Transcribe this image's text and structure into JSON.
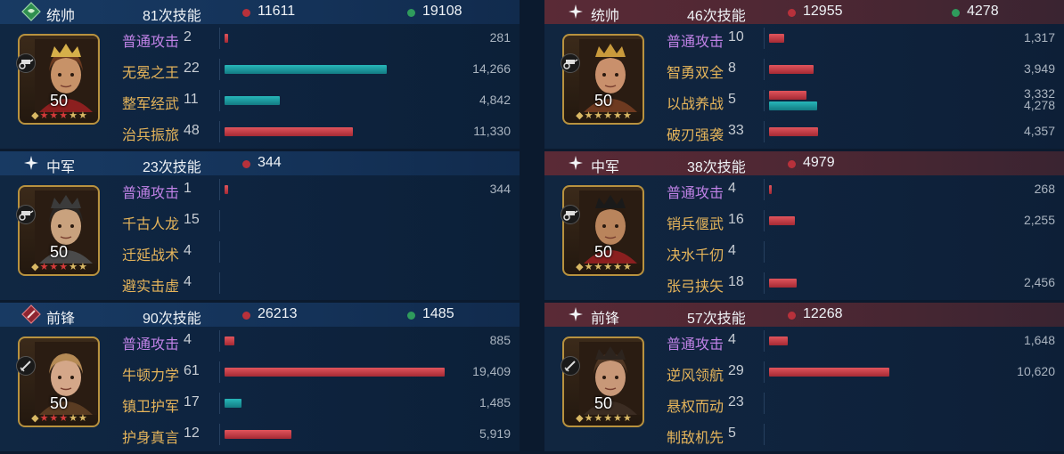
{
  "colors": {
    "damage_red": "#c23a44",
    "heal_teal": "#1b9ea3",
    "basic_attack_purple": "#c082e6",
    "skill_gold": "#e5b45a",
    "left_header": "#163660",
    "right_header": "#4f2733",
    "frame_gold": "#b8923f"
  },
  "left": {
    "sections": [
      {
        "role": "统帅",
        "role_icon": "green-diamond-badge-icon",
        "skill_count": "81次技能",
        "damage_total": "11611",
        "heal_total": "19108",
        "troop_icon": "chariot-icon",
        "level": "50",
        "stars": "red-3-gold-2",
        "skills": [
          {
            "name": "普通攻击",
            "count": "2",
            "bars": [
              {
                "color": "red",
                "value": 281,
                "label": "281"
              }
            ]
          },
          {
            "name": "无冕之王",
            "count": "22",
            "bars": [
              {
                "color": "teal",
                "value": 14266,
                "label": "14,266"
              }
            ]
          },
          {
            "name": "整军经武",
            "count": "11",
            "bars": [
              {
                "color": "teal",
                "value": 4842,
                "label": "4,842"
              }
            ]
          },
          {
            "name": "治兵振旅",
            "count": "48",
            "bars": [
              {
                "color": "red",
                "value": 11330,
                "label": "11,330"
              }
            ]
          }
        ]
      },
      {
        "role": "中军",
        "role_icon": "white-star-icon",
        "skill_count": "23次技能",
        "damage_total": "344",
        "heal_total": "",
        "troop_icon": "chariot-icon",
        "level": "50",
        "stars": "red-3-gold-2",
        "skills": [
          {
            "name": "普通攻击",
            "count": "1",
            "bars": [
              {
                "color": "red",
                "value": 344,
                "label": "344"
              }
            ]
          },
          {
            "name": "千古人龙",
            "count": "15",
            "bars": []
          },
          {
            "name": "迁延战术",
            "count": "4",
            "bars": []
          },
          {
            "name": "避实击虚",
            "count": "4",
            "bars": []
          }
        ]
      },
      {
        "role": "前锋",
        "role_icon": "red-sword-diamond-icon",
        "skill_count": "90次技能",
        "damage_total": "26213",
        "heal_total": "1485",
        "troop_icon": "sword-icon",
        "level": "50",
        "stars": "red-3-gold-2",
        "skills": [
          {
            "name": "普通攻击",
            "count": "4",
            "bars": [
              {
                "color": "red",
                "value": 885,
                "label": "885"
              }
            ]
          },
          {
            "name": "牛顿力学",
            "count": "61",
            "bars": [
              {
                "color": "red",
                "value": 19409,
                "label": "19,409"
              }
            ]
          },
          {
            "name": "镇卫护军",
            "count": "17",
            "bars": [
              {
                "color": "teal",
                "value": 1485,
                "label": "1,485"
              }
            ]
          },
          {
            "name": "护身真言",
            "count": "12",
            "bars": [
              {
                "color": "red",
                "value": 5919,
                "label": "5,919"
              }
            ]
          }
        ]
      }
    ]
  },
  "right": {
    "sections": [
      {
        "role": "统帅",
        "role_icon": "white-star-icon",
        "skill_count": "46次技能",
        "damage_total": "12955",
        "heal_total": "4278",
        "troop_icon": "chariot-icon",
        "level": "50",
        "stars": "gold-5",
        "skills": [
          {
            "name": "普通攻击",
            "count": "10",
            "bars": [
              {
                "color": "red",
                "value": 1317,
                "label": "1,317"
              }
            ]
          },
          {
            "name": "智勇双全",
            "count": "8",
            "bars": [
              {
                "color": "red",
                "value": 3949,
                "label": "3,949"
              }
            ]
          },
          {
            "name": "以战养战",
            "count": "5",
            "bars": [
              {
                "color": "red",
                "value": 3332,
                "label": "3,332"
              },
              {
                "color": "teal",
                "value": 4278,
                "label": "4,278"
              }
            ]
          },
          {
            "name": "破刃强袭",
            "count": "33",
            "bars": [
              {
                "color": "red",
                "value": 4357,
                "label": "4,357"
              }
            ]
          }
        ]
      },
      {
        "role": "中军",
        "role_icon": "white-star-icon",
        "skill_count": "38次技能",
        "damage_total": "4979",
        "heal_total": "",
        "troop_icon": "chariot-icon",
        "level": "50",
        "stars": "gold-5",
        "skills": [
          {
            "name": "普通攻击",
            "count": "4",
            "bars": [
              {
                "color": "red",
                "value": 268,
                "label": "268"
              }
            ]
          },
          {
            "name": "销兵偃武",
            "count": "16",
            "bars": [
              {
                "color": "red",
                "value": 2255,
                "label": "2,255"
              }
            ]
          },
          {
            "name": "决水千仞",
            "count": "4",
            "bars": []
          },
          {
            "name": "张弓挟矢",
            "count": "18",
            "bars": [
              {
                "color": "red",
                "value": 2456,
                "label": "2,456"
              }
            ]
          }
        ]
      },
      {
        "role": "前锋",
        "role_icon": "white-star-icon",
        "skill_count": "57次技能",
        "damage_total": "12268",
        "heal_total": "",
        "troop_icon": "sword-icon",
        "level": "50",
        "stars": "gold-5",
        "skills": [
          {
            "name": "普通攻击",
            "count": "4",
            "bars": [
              {
                "color": "red",
                "value": 1648,
                "label": "1,648"
              }
            ]
          },
          {
            "name": "逆风领航",
            "count": "29",
            "bars": [
              {
                "color": "red",
                "value": 10620,
                "label": "10,620"
              }
            ]
          },
          {
            "name": "悬权而动",
            "count": "23",
            "bars": []
          },
          {
            "name": "制敌机先",
            "count": "5",
            "bars": []
          }
        ]
      }
    ]
  }
}
